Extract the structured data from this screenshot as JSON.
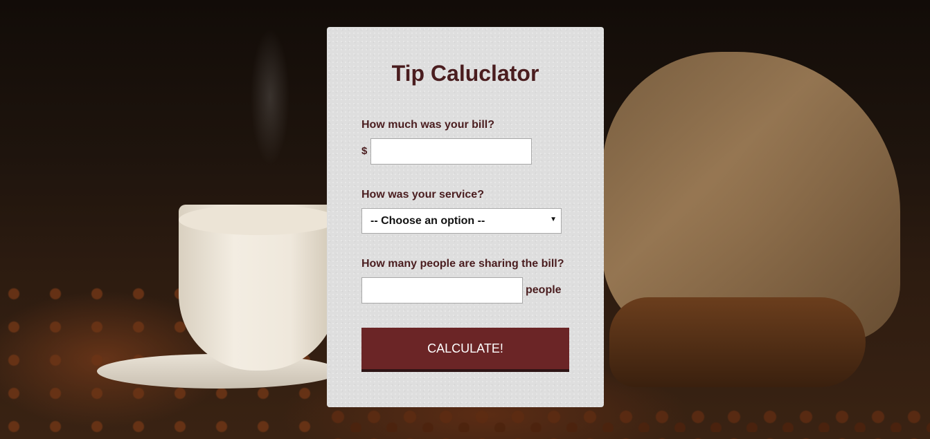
{
  "app": {
    "title": "Tip Caluclator"
  },
  "form": {
    "bill": {
      "label": "How much was your bill?",
      "currency_symbol": "$",
      "value": "",
      "placeholder": ""
    },
    "service": {
      "label": "How was your service?",
      "selected": "-- Choose an option --",
      "chevron_icon": "chevron-down-icon"
    },
    "people": {
      "label": "How many people are sharing the bill?",
      "value": "",
      "placeholder": "",
      "unit": "people"
    },
    "calculate_label": "CALCULATE!"
  },
  "colors": {
    "accent": "#6b2526",
    "text": "#4a1d1f",
    "card_background": "#dedede"
  }
}
